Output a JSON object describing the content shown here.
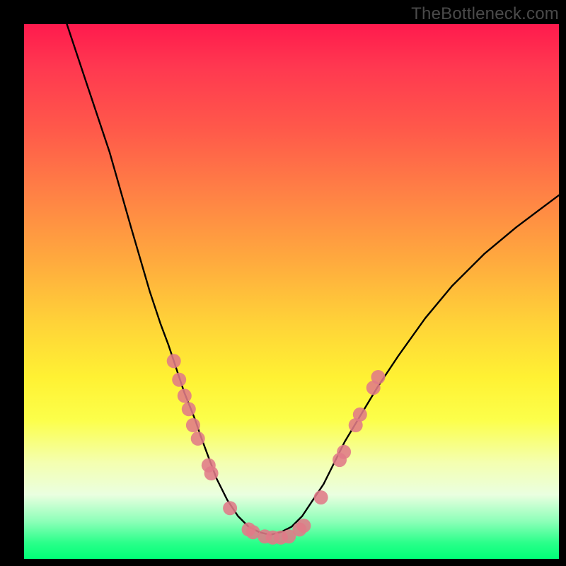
{
  "watermark": "TheBottleneck.com",
  "chart_data": {
    "type": "line",
    "title": "",
    "xlabel": "",
    "ylabel": "",
    "xlim": [
      0,
      100
    ],
    "ylim": [
      0,
      100
    ],
    "series": [
      {
        "name": "curve-left",
        "x": [
          8,
          12,
          16,
          20,
          23.5,
          25.5,
          27,
          28,
          29,
          30,
          31,
          32,
          33,
          34.5,
          36,
          38,
          40,
          42,
          44,
          46
        ],
        "y": [
          100,
          88,
          76,
          62,
          50,
          44,
          40,
          37,
          34,
          31,
          28.5,
          26,
          23,
          19,
          15,
          11,
          8,
          6,
          5,
          4.5
        ]
      },
      {
        "name": "curve-right",
        "x": [
          46,
          48,
          50,
          52,
          54,
          56,
          58,
          60,
          63,
          66,
          70,
          75,
          80,
          86,
          92,
          100
        ],
        "y": [
          4.5,
          5,
          6,
          8,
          11,
          14,
          18,
          22,
          27,
          32,
          38,
          45,
          51,
          57,
          62,
          68
        ]
      }
    ],
    "scatter": {
      "name": "marker-points",
      "color": "#e07a88",
      "radius": 10,
      "points": [
        {
          "x": 28.0,
          "y": 37.0
        },
        {
          "x": 29.0,
          "y": 33.5
        },
        {
          "x": 30.0,
          "y": 30.5
        },
        {
          "x": 30.8,
          "y": 28.0
        },
        {
          "x": 31.6,
          "y": 25.0
        },
        {
          "x": 32.5,
          "y": 22.5
        },
        {
          "x": 34.5,
          "y": 17.5
        },
        {
          "x": 35.0,
          "y": 16.0
        },
        {
          "x": 38.5,
          "y": 9.5
        },
        {
          "x": 42.0,
          "y": 5.5
        },
        {
          "x": 42.8,
          "y": 5.0
        },
        {
          "x": 45.0,
          "y": 4.2
        },
        {
          "x": 46.5,
          "y": 4.0
        },
        {
          "x": 48.0,
          "y": 4.0
        },
        {
          "x": 49.5,
          "y": 4.2
        },
        {
          "x": 51.5,
          "y": 5.5
        },
        {
          "x": 52.3,
          "y": 6.2
        },
        {
          "x": 55.5,
          "y": 11.5
        },
        {
          "x": 59.0,
          "y": 18.5
        },
        {
          "x": 59.8,
          "y": 20.0
        },
        {
          "x": 62.0,
          "y": 25.0
        },
        {
          "x": 62.8,
          "y": 27.0
        },
        {
          "x": 65.3,
          "y": 32.0
        },
        {
          "x": 66.2,
          "y": 34.0
        }
      ]
    }
  }
}
